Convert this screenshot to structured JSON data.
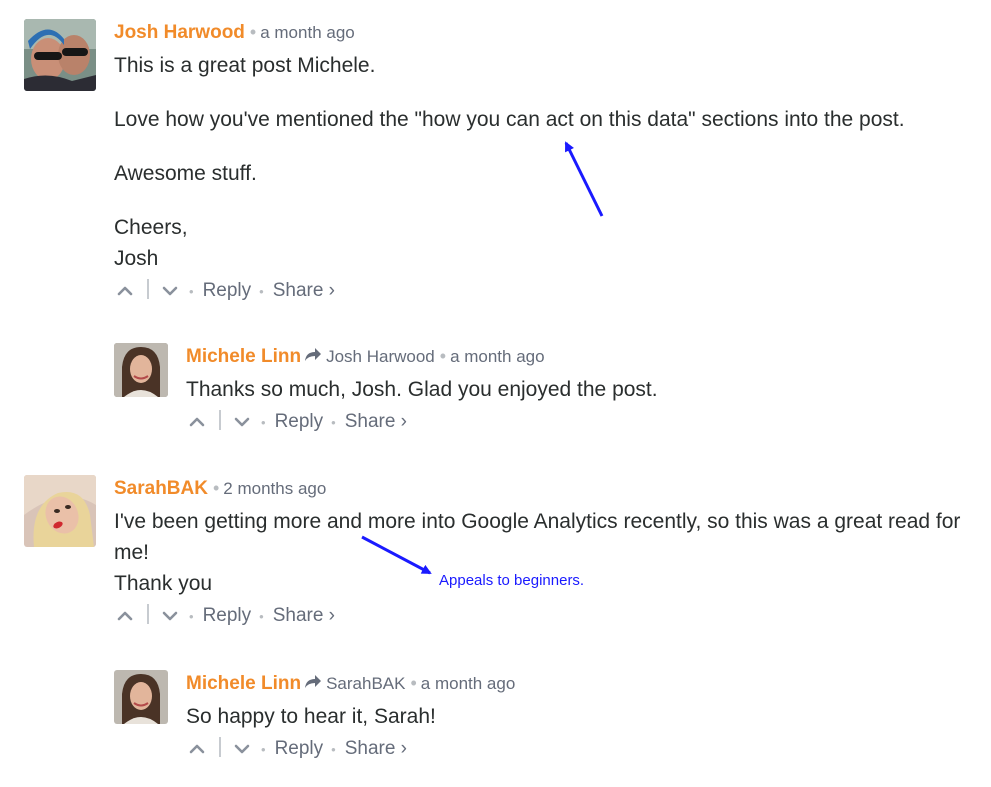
{
  "colors": {
    "author": "#f18b2a",
    "muted": "#656c7a",
    "annotation": "#1a1aff"
  },
  "separator": "•",
  "reply_arrow_icon": "share-arrow-icon",
  "actions": {
    "reply": "Reply",
    "share": "Share ›"
  },
  "comments": [
    {
      "author": "Josh Harwood",
      "time": "a month ago",
      "paragraphs": [
        "This is a great post Michele.",
        "Love how you've mentioned the \"how you can act on this data\" sections into the post.",
        "Awesome stuff.",
        "Cheers,",
        "Josh"
      ]
    },
    {
      "author": "Michele Linn",
      "reply_to": "Josh Harwood",
      "time": "a month ago",
      "paragraphs": [
        "Thanks so much, Josh. Glad you enjoyed the post."
      ]
    },
    {
      "author": "SarahBAK",
      "time": "2 months ago",
      "paragraphs": [
        "I've been getting more and more into Google Analytics recently, so this was a great read for me!",
        "Thank you"
      ]
    },
    {
      "author": "Michele Linn",
      "reply_to": "SarahBAK",
      "time": "a month ago",
      "paragraphs": [
        "So happy to hear it, Sarah!"
      ]
    }
  ],
  "annotation": {
    "text": "Appeals to beginners."
  }
}
